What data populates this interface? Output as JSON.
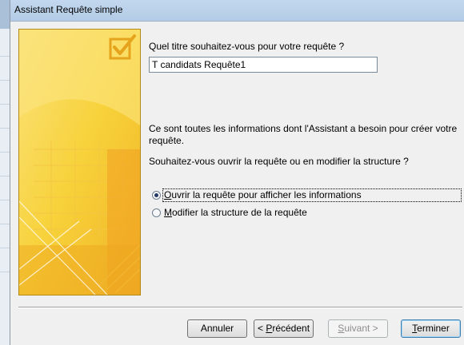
{
  "window": {
    "title": "Assistant Requête simple"
  },
  "form": {
    "question_title": "Quel titre souhaitez-vous pour votre requête ?",
    "title_value": "T candidats Requête1",
    "info_line1": "Ce sont toutes les informations dont l'Assistant a besoin pour créer votre",
    "info_line2": "requête.",
    "question_open": "Souhaitez-vous ouvrir la requête ou en modifier la structure ?",
    "options": [
      {
        "accel": "O",
        "rest": "uvrir la requête pour afficher les informations",
        "checked": true
      },
      {
        "accel": "M",
        "rest": "odifier la structure de la requête",
        "checked": false
      }
    ]
  },
  "buttons": {
    "cancel": "Annuler",
    "previous_prefix": "< ",
    "previous_accel": "P",
    "previous_rest": "récédent",
    "next_accel": "S",
    "next_rest": "uivant >",
    "next_enabled": false,
    "finish_accel": "T",
    "finish_rest": "erminer"
  },
  "colors": {
    "illustration_yellow": "#f7d23a",
    "illustration_orange": "#f0a020",
    "checkmark": "#e6a31c"
  },
  "icons": {
    "illustration_check": "checkmark-icon"
  }
}
